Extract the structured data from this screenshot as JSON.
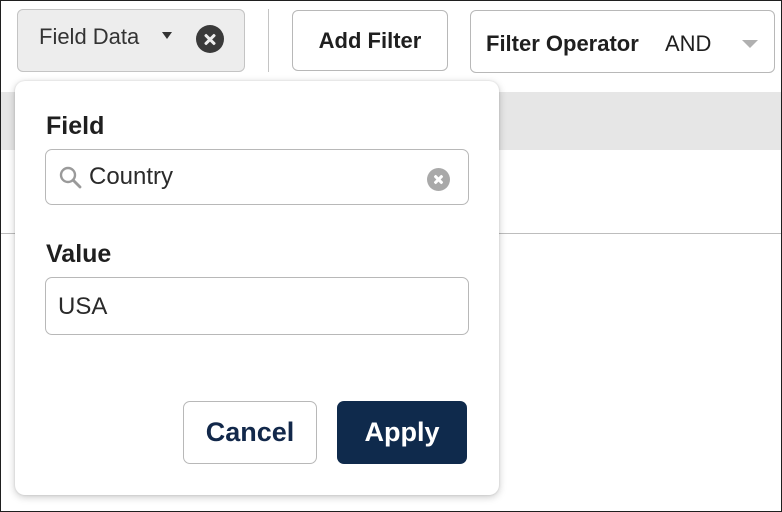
{
  "toolbar": {
    "field_chip_label": "Field Data",
    "add_filter_label": "Add Filter",
    "filter_operator_label": "Filter Operator",
    "filter_operator_value": "AND"
  },
  "popover": {
    "field_label": "Field",
    "field_value": "Country",
    "value_label": "Value",
    "value_value": "USA",
    "cancel_label": "Cancel",
    "apply_label": "Apply"
  },
  "icons": {
    "chip_clear": "close-circle-icon",
    "chip_caret": "caret-down-icon",
    "operator_caret": "chevron-down-icon",
    "search": "search-icon",
    "field_clear": "clear-input-icon"
  },
  "colors": {
    "primary_button": "#0f2a4c",
    "cancel_text": "#12284a",
    "header_band": "#e6e6e6",
    "chip_background": "#ededed"
  }
}
